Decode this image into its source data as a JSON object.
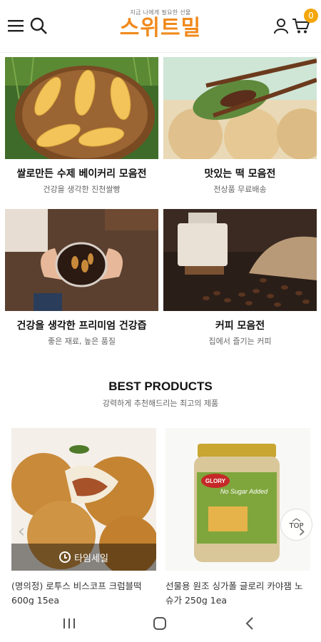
{
  "header": {
    "tagline": "지금 나에게 필요한 선물",
    "brand": "스위트밀",
    "cart_count": "0",
    "icons": [
      "menu-icon",
      "search-icon",
      "user-icon",
      "cart-icon"
    ]
  },
  "categories": [
    {
      "title": "쌀로만든 수제 베이커리 모음전",
      "subtitle": "건강을 생각한 진천쌀빵"
    },
    {
      "title": "맛있는 떡 모음전",
      "subtitle": "전상품 무료배송"
    },
    {
      "title": "건강을 생각한 프리미엄 건강즙",
      "subtitle": "좋은 재료, 높은 품질"
    },
    {
      "title": "커피 모음전",
      "subtitle": "집에서 즐기는 커피"
    }
  ],
  "best": {
    "title": "BEST PRODUCTS",
    "subtitle": "강력하게 추천해드리는 최고의 제품"
  },
  "products": [
    {
      "name": "(명의정) 로투스 비스코프 크럼블떡 600g 15ea",
      "badge": "타임세일"
    },
    {
      "name": "선물용 원조 싱가폴 글로리 카야잼 노슈가 250g 1ea",
      "jar_label": "GLORY",
      "jar_sub": "No Sugar Added"
    }
  ],
  "top_button": "TOP",
  "colors": {
    "brand": "#f08a1c",
    "badge": "#f4a60a"
  }
}
